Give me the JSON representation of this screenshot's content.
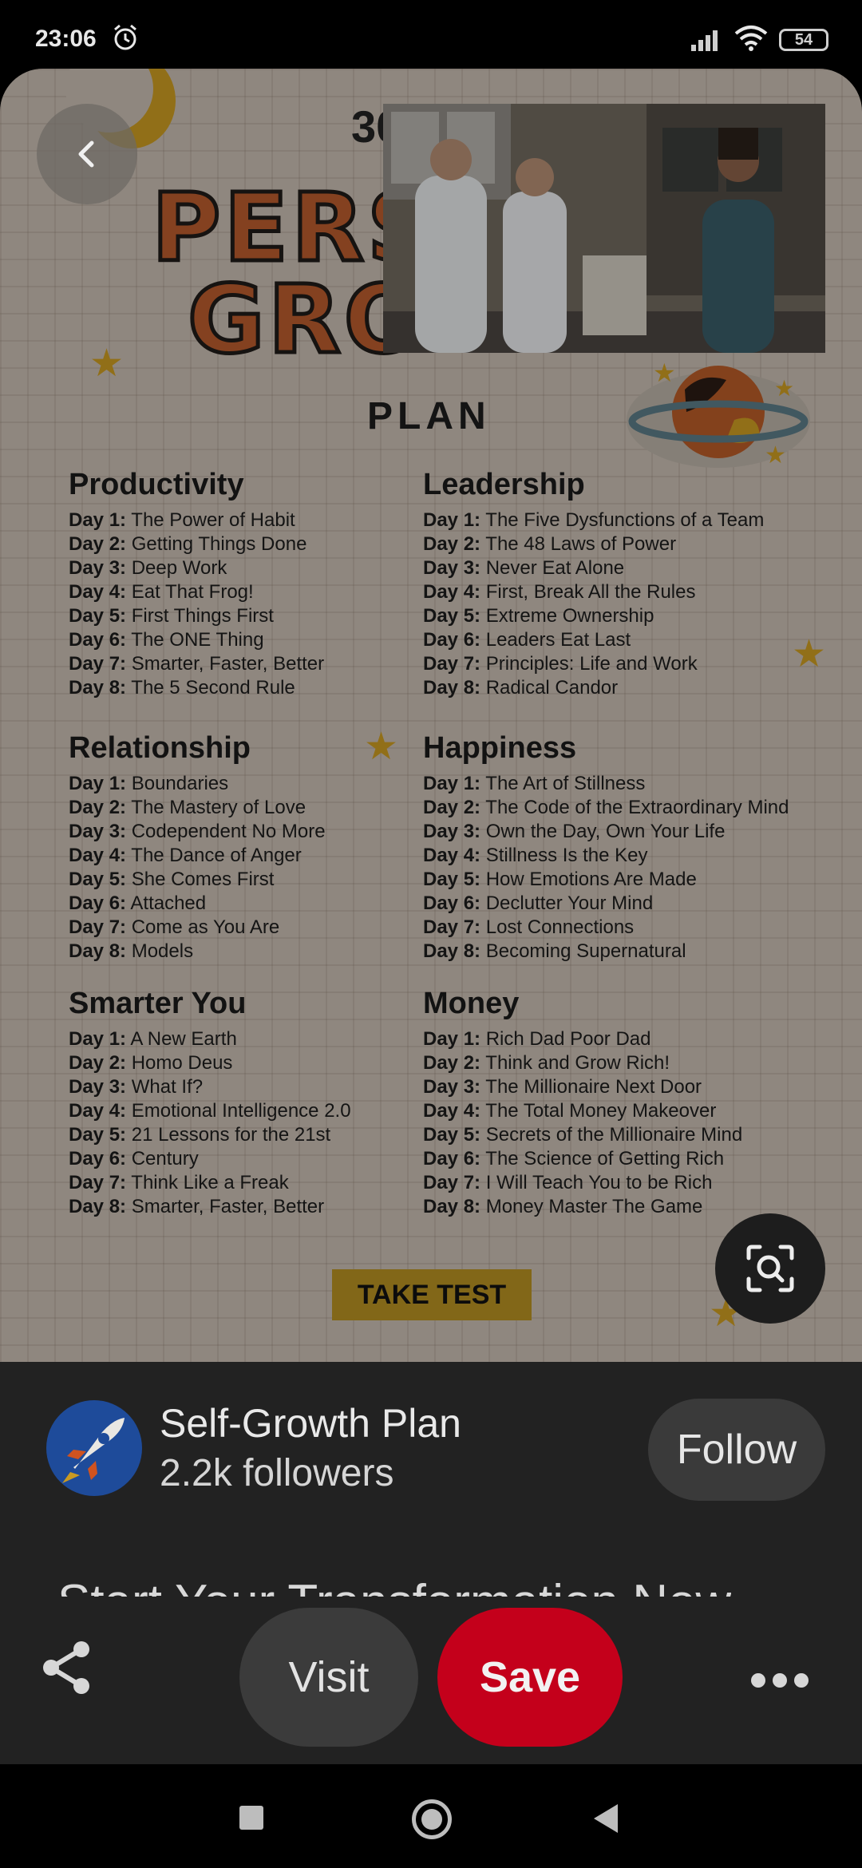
{
  "status_bar": {
    "time": "23:06",
    "battery": "54"
  },
  "pin_image": {
    "title_number": "30",
    "title_line1": "PERS",
    "title_line2": "GRO",
    "plan_label": "PLAN",
    "take_test": "TAKE TEST",
    "sections": [
      {
        "heading": "Productivity",
        "items": [
          {
            "day": "Day 1:",
            "title": "The Power of Habit"
          },
          {
            "day": "Day 2:",
            "title": "Getting Things Done"
          },
          {
            "day": "Day 3:",
            "title": "Deep Work"
          },
          {
            "day": "Day 4:",
            "title": "Eat That Frog!"
          },
          {
            "day": "Day 5:",
            "title": "First Things First"
          },
          {
            "day": "Day 6:",
            "title": "The ONE Thing"
          },
          {
            "day": "Day 7:",
            "title": "Smarter, Faster, Better"
          },
          {
            "day": "Day 8:",
            "title": "The 5 Second Rule"
          }
        ]
      },
      {
        "heading": "Leadership",
        "items": [
          {
            "day": "Day 1:",
            "title": "The Five Dysfunctions of a Team"
          },
          {
            "day": "Day 2:",
            "title": "The 48 Laws of Power"
          },
          {
            "day": "Day 3:",
            "title": "Never Eat Alone"
          },
          {
            "day": "Day 4:",
            "title": "First, Break All the Rules"
          },
          {
            "day": "Day 5:",
            "title": "Extreme Ownership"
          },
          {
            "day": "Day 6:",
            "title": "Leaders Eat Last"
          },
          {
            "day": "Day 7:",
            "title": "Principles: Life and Work"
          },
          {
            "day": "Day 8:",
            "title": "Radical Candor"
          }
        ]
      },
      {
        "heading": "Relationship",
        "items": [
          {
            "day": "Day 1:",
            "title": "Boundaries"
          },
          {
            "day": "Day 2:",
            "title": "The Mastery of Love"
          },
          {
            "day": "Day 3:",
            "title": "Codependent No More"
          },
          {
            "day": "Day 4:",
            "title": "The Dance of Anger"
          },
          {
            "day": "Day 5:",
            "title": "She Comes First"
          },
          {
            "day": "Day 6:",
            "title": "Attached"
          },
          {
            "day": "Day 7:",
            "title": "Come as You Are"
          },
          {
            "day": "Day 8:",
            "title": "Models"
          }
        ]
      },
      {
        "heading": "Happiness",
        "items": [
          {
            "day": "Day 1:",
            "title": "The Art of Stillness"
          },
          {
            "day": "Day 2:",
            "title": "The Code of the Extraordinary Mind"
          },
          {
            "day": "Day 3:",
            "title": "Own the Day, Own Your Life"
          },
          {
            "day": "Day 4:",
            "title": "Stillness Is the Key"
          },
          {
            "day": "Day 5:",
            "title": "How Emotions Are Made"
          },
          {
            "day": "Day 6:",
            "title": "Declutter Your Mind"
          },
          {
            "day": "Day 7:",
            "title": "Lost Connections"
          },
          {
            "day": "Day 8:",
            "title": "Becoming Supernatural"
          }
        ]
      },
      {
        "heading": "Smarter You",
        "items": [
          {
            "day": "Day 1:",
            "title": "A New Earth"
          },
          {
            "day": "Day 2:",
            "title": "Homo Deus"
          },
          {
            "day": "Day 3:",
            "title": "What If?"
          },
          {
            "day": "Day 4:",
            "title": "Emotional Intelligence 2.0"
          },
          {
            "day": "Day 5:",
            "title": "21 Lessons for the 21st"
          },
          {
            "day": "Day 6:",
            "title": "Century"
          },
          {
            "day": "Day 7:",
            "title": "Think Like a Freak"
          },
          {
            "day": "Day 8:",
            "title": "Smarter, Faster, Better"
          }
        ]
      },
      {
        "heading": "Money",
        "items": [
          {
            "day": "Day 1:",
            "title": "Rich Dad Poor Dad"
          },
          {
            "day": "Day 2:",
            "title": "Think and Grow Rich!"
          },
          {
            "day": "Day 3:",
            "title": "The Millionaire Next Door"
          },
          {
            "day": "Day 4:",
            "title": "The Total Money Makeover"
          },
          {
            "day": "Day 5:",
            "title": "Secrets of the Millionaire Mind"
          },
          {
            "day": "Day 6:",
            "title": "The Science of Getting Rich"
          },
          {
            "day": "Day 7:",
            "title": "I Will Teach You to be Rich"
          },
          {
            "day": "Day 8:",
            "title": "Money Master The Game"
          }
        ]
      }
    ]
  },
  "creator": {
    "name": "Self-Growth Plan",
    "followers": "2.2k followers",
    "follow_label": "Follow"
  },
  "pin_title": "Start Your Transformation Now",
  "actions": {
    "visit_label": "Visit",
    "save_label": "Save"
  },
  "icons": {
    "back": "chevron-left-icon",
    "lens": "visual-search-icon",
    "share": "share-icon",
    "more": "more-dots-icon",
    "alarm": "alarm-icon",
    "signal": "signal-icon",
    "wifi": "wifi-icon"
  },
  "colors": {
    "save": "#c4001b",
    "accent_orange": "#b85a2d",
    "gold": "#c99a22",
    "panel": "#222222"
  }
}
